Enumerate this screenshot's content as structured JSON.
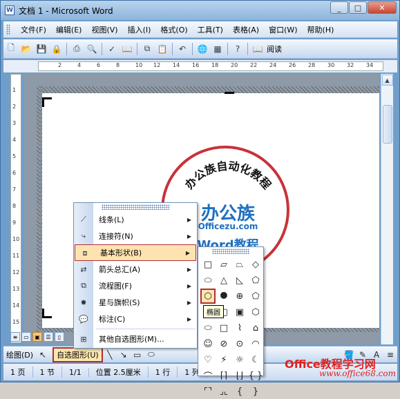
{
  "window": {
    "title": "文档 1 - Microsoft Word",
    "app_icon": "W",
    "min": "_",
    "max": "□",
    "close": "✕"
  },
  "menubar": {
    "items": [
      "文件(F)",
      "编辑(E)",
      "视图(V)",
      "插入(I)",
      "格式(O)",
      "工具(T)",
      "表格(A)",
      "窗口(W)",
      "帮助(H)"
    ]
  },
  "toolbar": {
    "read_label": "阅读",
    "icons": [
      "new-doc-icon",
      "open-icon",
      "save-icon",
      "permission-icon",
      "print-icon",
      "print-preview-icon",
      "spelling-icon",
      "research-icon",
      "copy-icon",
      "paste-icon",
      "undo-icon",
      "insert-hyperlink-icon",
      "tables-icon",
      "help-icon",
      "read-mode-icon"
    ]
  },
  "ruler": {
    "ticks": [
      "2",
      "4",
      "6",
      "8",
      "10",
      "12",
      "14",
      "16",
      "18",
      "20",
      "22",
      "24",
      "26",
      "28",
      "30",
      "32",
      "34"
    ]
  },
  "vruler": {
    "ticks": [
      "1",
      "2",
      "3",
      "4",
      "5",
      "6",
      "7",
      "8",
      "9",
      "10",
      "11",
      "12",
      "13",
      "14",
      "15"
    ]
  },
  "stamp": {
    "arc_text": "办公族自动化教程",
    "brand": "办公族",
    "url": "Officezu.com",
    "word": "Word教程"
  },
  "autoshape_menu": {
    "items": [
      {
        "label": "线条(L)",
        "has_submenu": true
      },
      {
        "label": "连接符(N)",
        "has_submenu": true
      },
      {
        "label": "基本形状(B)",
        "has_submenu": true,
        "highlighted": true
      },
      {
        "label": "箭头总汇(A)",
        "has_submenu": true
      },
      {
        "label": "流程图(F)",
        "has_submenu": true
      },
      {
        "label": "星与旗帜(S)",
        "has_submenu": true
      },
      {
        "label": "标注(C)",
        "has_submenu": true
      },
      {
        "label": "其他自选图形(M)...",
        "has_submenu": false
      }
    ]
  },
  "shapes": {
    "tooltip": "椭圆",
    "grid": [
      "□",
      "▱",
      "⏢",
      "◇",
      "⬭",
      "△",
      "◺",
      "⬠",
      "⬡",
      "⯃",
      "⊕",
      "⬠",
      "⬭",
      "▢",
      "▣",
      "⬡",
      "⬭",
      "□",
      "⌇",
      "⌂",
      "☺",
      "⊘",
      "⊙",
      "◠",
      "♡",
      "⚡",
      "☼",
      "☾",
      "⌒",
      "⌈⌉",
      "⌊⌋",
      "{ }",
      "⌜⌝",
      "⌟⌞",
      "{",
      "}"
    ],
    "selected_index": 8
  },
  "drawbar": {
    "draw_label": "绘图(D)",
    "autoshape_label": "自选图形(U)"
  },
  "statusbar": {
    "page": "1 页",
    "section": "1 节",
    "pages": "1/1",
    "position": "位置 2.5厘米",
    "line": "1 行",
    "col": "1 列"
  },
  "watermark": {
    "line1": "Office教程学习网",
    "line2": "www.office68.com"
  }
}
